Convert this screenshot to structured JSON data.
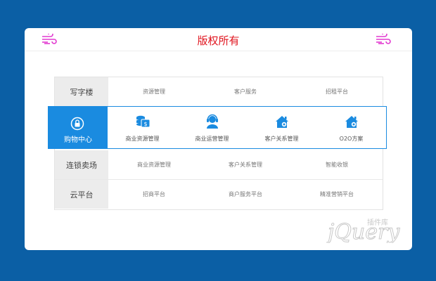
{
  "header": {
    "title": "版权所有"
  },
  "rows": [
    {
      "label": "写字楼",
      "items": [
        "资源管理",
        "客户服务",
        "招租平台"
      ]
    },
    {
      "label": "购物中心",
      "items": [
        "商业资源管理",
        "商业运营管理",
        "客户关系管理",
        "O2O方案"
      ]
    },
    {
      "label": "连锁卖场",
      "items": [
        "商业资源管理",
        "客户关系管理",
        "智能收银"
      ]
    },
    {
      "label": "云平台",
      "items": [
        "招商平台",
        "商户服务平台",
        "精准营销平台"
      ]
    }
  ],
  "active_row_index": 1,
  "watermark": {
    "text": "jQuery",
    "sub": "插件库"
  },
  "colors": {
    "background": "#0b5fa5",
    "accent": "#1a8be0",
    "title": "#e0141e",
    "wind": "#e23ad0"
  }
}
